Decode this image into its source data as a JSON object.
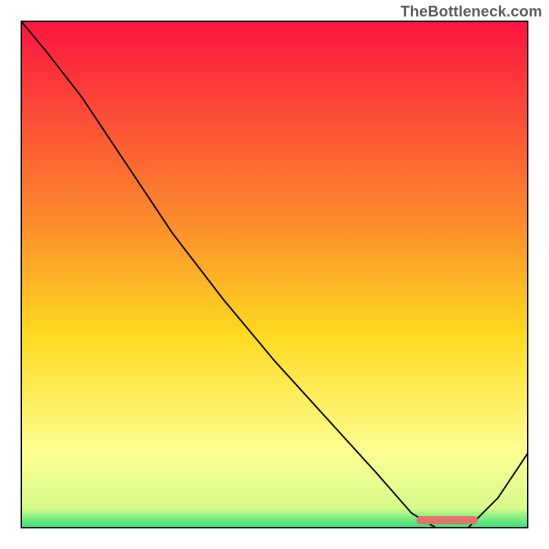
{
  "watermark": "TheBottleneck.com",
  "colors": {
    "top": "#fd1440",
    "mid": "#feda21",
    "lower": "#fdfe92",
    "bottom": "#2cdf78",
    "line": "#000000",
    "marker": "#e2746e",
    "frame": "#000000"
  },
  "chart_data": {
    "type": "line",
    "title": "",
    "xlabel": "",
    "ylabel": "",
    "xlim": [
      0,
      100
    ],
    "ylim": [
      0,
      100
    ],
    "grid": false,
    "legend": false,
    "series": [
      {
        "name": "bottleneck-curve",
        "x": [
          0,
          5,
          12,
          20,
          30,
          40,
          50,
          60,
          70,
          77,
          82,
          88,
          94,
          100
        ],
        "y": [
          100,
          94,
          85,
          73,
          58,
          45,
          33,
          22,
          11,
          3,
          0,
          0,
          6,
          15
        ]
      }
    ],
    "annotations": [
      {
        "name": "optimal-marker",
        "x_start": 78,
        "x_end": 90,
        "y": 0.8
      }
    ],
    "gradient_stops": [
      {
        "pos": 0,
        "color": "#fd1440"
      },
      {
        "pos": 40,
        "color": "#fb8d2c"
      },
      {
        "pos": 62,
        "color": "#feda21"
      },
      {
        "pos": 85,
        "color": "#fdfe92"
      },
      {
        "pos": 96,
        "color": "#d7fb8c"
      },
      {
        "pos": 100,
        "color": "#2cdf78"
      }
    ]
  }
}
